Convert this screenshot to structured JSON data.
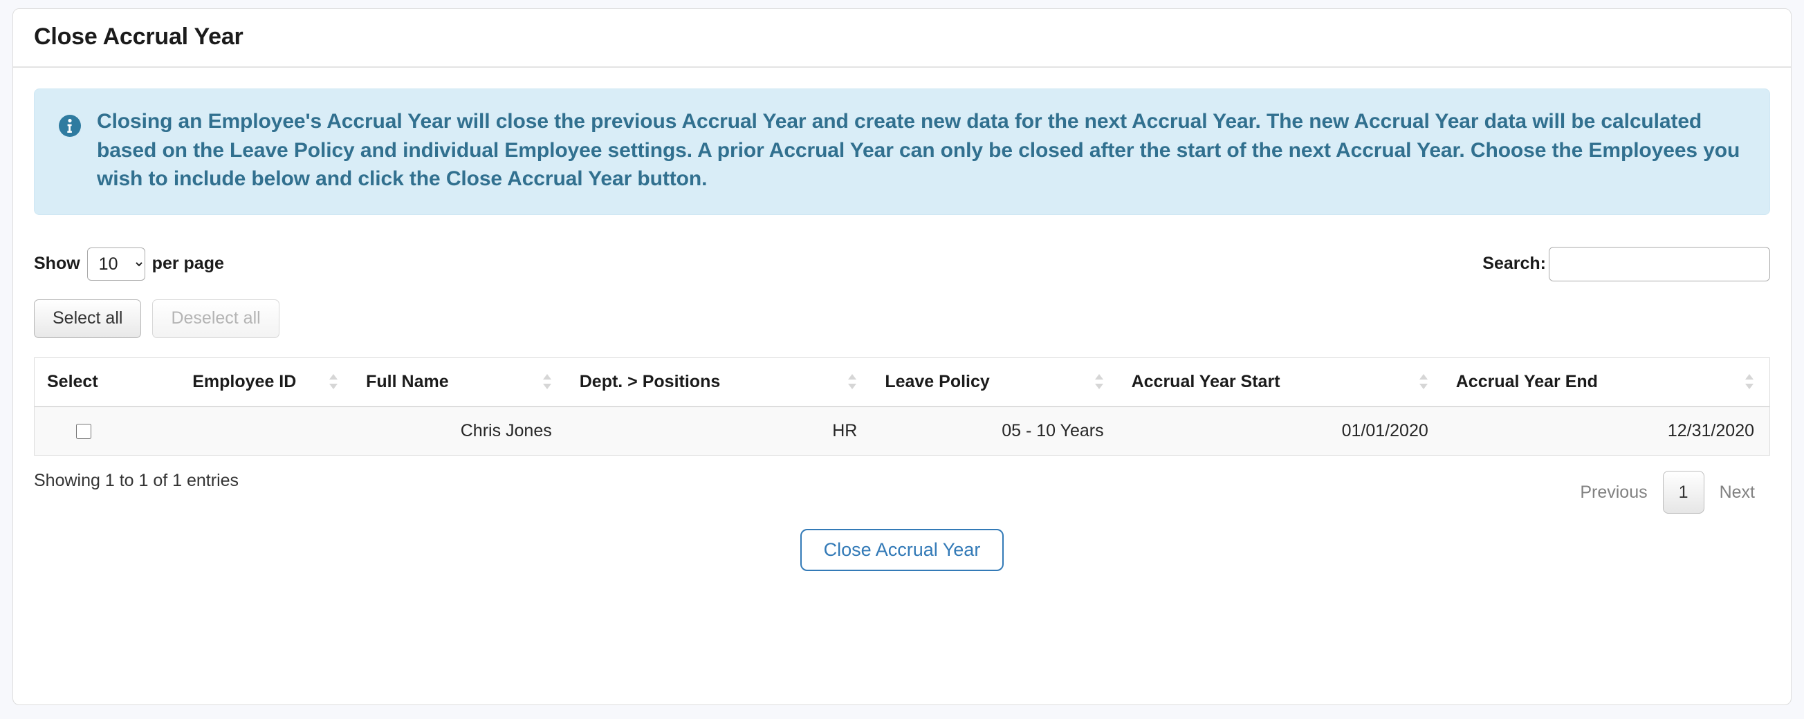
{
  "page": {
    "background_color": "#f7f8fc"
  },
  "card": {
    "title": "Close Accrual Year"
  },
  "alert": {
    "icon": "info-circle-icon",
    "text_color": "#31708f",
    "background_color": "#d9edf7",
    "message": "Closing an Employee's Accrual Year will close the previous Accrual Year and create new data for the next Accrual Year. The new Accrual Year data will be calculated based on the Leave Policy and individual Employee settings. A prior Accrual Year can only be closed after the start of the next Accrual Year. Choose the Employees you wish to include below and click the Close Accrual Year button."
  },
  "controls": {
    "show_label": "Show",
    "per_page_label": "per page",
    "page_length_value": "10",
    "page_length_options": [
      "10",
      "25",
      "50",
      "100"
    ],
    "search_label": "Search:",
    "search_value": "",
    "search_placeholder": ""
  },
  "selection_buttons": {
    "select_all_label": "Select all",
    "deselect_all_label": "Deselect all",
    "deselect_all_disabled": true
  },
  "table": {
    "columns": [
      {
        "label": "Select",
        "sortable": false
      },
      {
        "label": "Employee ID",
        "sortable": true
      },
      {
        "label": "Full Name",
        "sortable": true
      },
      {
        "label": "Dept. > Positions",
        "sortable": true
      },
      {
        "label": "Leave Policy",
        "sortable": true
      },
      {
        "label": "Accrual Year Start",
        "sortable": true
      },
      {
        "label": "Accrual Year End",
        "sortable": true
      }
    ],
    "rows": [
      {
        "selected": false,
        "employee_id": "",
        "full_name": "Chris Jones",
        "dept_positions": "HR",
        "leave_policy": "05 - 10 Years",
        "accrual_year_start": "01/01/2020",
        "accrual_year_end": "12/31/2020"
      }
    ]
  },
  "footer": {
    "entries_info": "Showing 1 to 1 of 1 entries",
    "previous_label": "Previous",
    "page_number": "1",
    "next_label": "Next"
  },
  "action": {
    "close_accrual_year_label": "Close Accrual Year",
    "accent_color": "#337ab7"
  }
}
